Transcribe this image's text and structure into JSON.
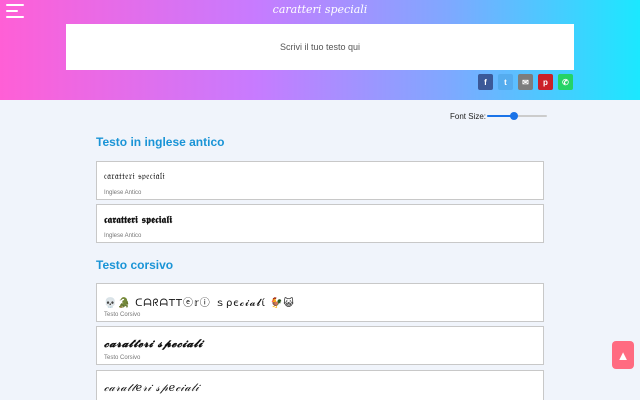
{
  "header": {
    "title": "caratteri speciali",
    "input_placeholder": "Scrivi il tuo testo qui",
    "share": [
      {
        "name": "facebook",
        "glyph": "f"
      },
      {
        "name": "twitter",
        "glyph": "t"
      },
      {
        "name": "email",
        "glyph": "✉"
      },
      {
        "name": "pinterest",
        "glyph": "p"
      },
      {
        "name": "whatsapp",
        "glyph": "✆"
      }
    ]
  },
  "controls": {
    "font_size_label": "Font Size:",
    "font_size_percent": 45
  },
  "sections": [
    {
      "title": "Testo in inglese antico",
      "cards": [
        {
          "text": "𝔠𝔞𝔯𝔞𝔱𝔱𝔢𝔯𝔦 𝔰𝔭𝔢𝔠𝔦𝔞𝔩𝔦",
          "label": "Inglese Antico"
        },
        {
          "text": "𝖈𝖆𝖗𝖆𝖙𝖙𝖊𝖗𝖎 𝖘𝖕𝖊𝖈𝖎𝖆𝖑𝖎",
          "label": "Inglese Antico"
        }
      ]
    },
    {
      "title": "Testo corsivo",
      "cards": [
        {
          "text": "💀🐊 ᑕᗩᖇᗩTTⓔ𝕣ⓘ ｓρє𝓬𝓲𝓪𝓵ί 🐓😺",
          "label": "Testo Corsivo"
        },
        {
          "text": "𝓬𝓪𝓻𝓪𝓽𝓽𝓮𝓻𝓲 𝓼𝓹𝓮𝓬𝓲𝓪𝓵𝓲",
          "label": "Testo Corsivo"
        },
        {
          "text": "𝒸𝒶𝓇𝒶𝓉𝓉𝑒𝓇𝒾 𝓈𝓅𝑒𝒸𝒾𝒶𝓁𝒾",
          "label": ""
        }
      ]
    }
  ],
  "scroll_top_glyph": "▲",
  "colors": {
    "section_title": "#1a94d6",
    "slider": "#1a73e8",
    "scroll_top": "#ff6b81",
    "facebook": "#3b5998",
    "twitter": "#55acee",
    "email": "#7d7d7d",
    "pinterest": "#cb2027",
    "whatsapp": "#25d366"
  }
}
